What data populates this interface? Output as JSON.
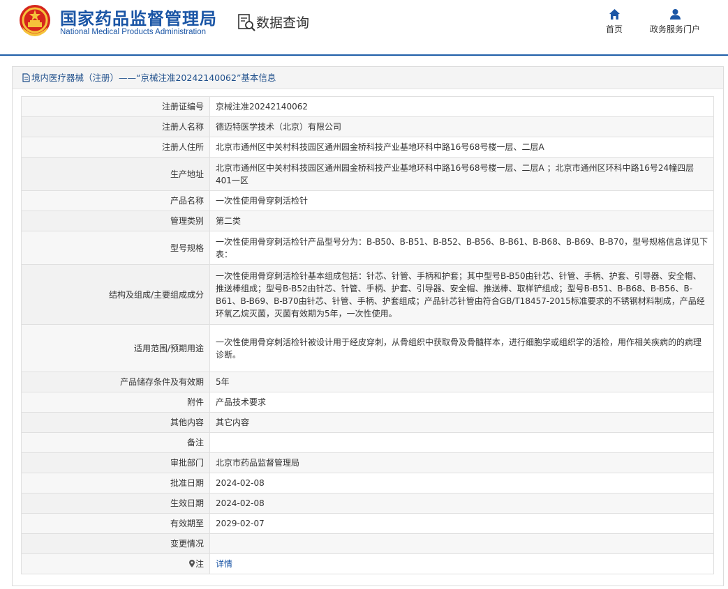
{
  "header": {
    "org_name_cn": "国家药品监督管理局",
    "org_name_en": "National Medical Products Administration",
    "section_title": "数据查询",
    "nav": [
      {
        "label": "首页",
        "icon": "home-icon"
      },
      {
        "label": "政务服务门户",
        "icon": "user-icon"
      }
    ],
    "brand_color": "#1a55a5"
  },
  "panel": {
    "title": "境内医疗器械（注册）——“京械注准20242140062”基本信息"
  },
  "rows": [
    {
      "label": "注册证编号",
      "value": "京械注准20242140062"
    },
    {
      "label": "注册人名称",
      "value": "德迈特医学技术（北京）有限公司"
    },
    {
      "label": "注册人住所",
      "value": "北京市通州区中关村科技园区通州园金桥科技产业基地环科中路16号68号楼一层、二层A"
    },
    {
      "label": "生产地址",
      "value": "北京市通州区中关村科技园区通州园金桥科技产业基地环科中路16号68号楼一层、二层A ；北京市通州区环科中路16号24幢四层401一区"
    },
    {
      "label": "产品名称",
      "value": "一次性使用骨穿刺活检针"
    },
    {
      "label": "管理类别",
      "value": "第二类"
    },
    {
      "label": "型号规格",
      "value": "一次性使用骨穿刺活检针产品型号分为：B-B50、B-B51、B-B52、B-B56、B-B61、B-B68、B-B69、B-B70，型号规格信息详见下表："
    },
    {
      "label": "结构及组成/主要组成成分",
      "value": "一次性使用骨穿刺活检针基本组成包括：针芯、针管、手柄和护套；其中型号B-B50由针芯、针管、手柄、护套、引导器、安全帽、推送棒组成；型号B-B52由针芯、针管、手柄、护套、引导器、安全帽、推送棒、取样铲组成；型号B-B51、B-B68、B-B56、B-B61、B-B69、B-B70由针芯、针管、手柄、护套组成；产品针芯针管由符合GB/T18457-2015标准要求的不锈钢材料制成，产品经环氧乙烷灭菌，灭菌有效期为5年，一次性使用。"
    },
    {
      "label": "适用范围/预期用途",
      "value": "一次性使用骨穿刺活检针被设计用于经皮穿刺，从骨组织中获取骨及骨髓样本，进行细胞学或组织学的活检，用作相关疾病的的病理诊断。"
    },
    {
      "label": "产品储存条件及有效期",
      "value": "5年"
    },
    {
      "label": "附件",
      "value": "产品技术要求"
    },
    {
      "label": "其他内容",
      "value": "其它内容"
    },
    {
      "label": "备注",
      "value": ""
    },
    {
      "label": "审批部门",
      "value": "北京市药品监督管理局"
    },
    {
      "label": "批准日期",
      "value": "2024-02-08"
    },
    {
      "label": "生效日期",
      "value": "2024-02-08"
    },
    {
      "label": "有效期至",
      "value": "2029-02-07"
    },
    {
      "label": "变更情况",
      "value": ""
    },
    {
      "label": "注",
      "value": "详情",
      "icon": "pin-icon",
      "is_link": true
    }
  ]
}
